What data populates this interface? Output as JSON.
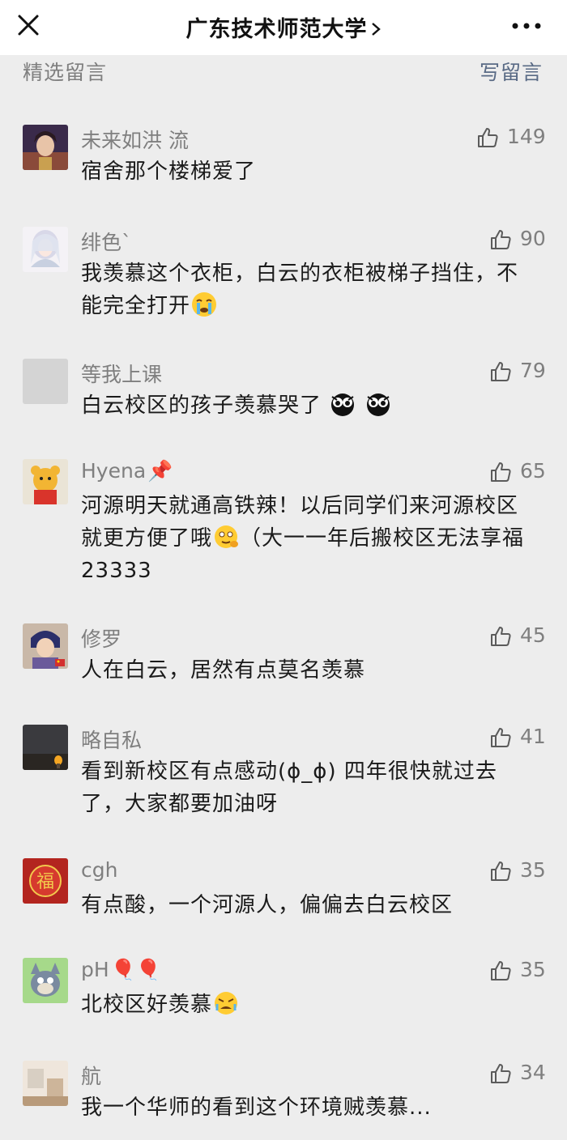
{
  "header": {
    "title": "广东技术师范大学",
    "chevron_icon": "chevron-right-icon",
    "close_icon": "close-icon",
    "more_icon": "more-dots-icon"
  },
  "section": {
    "label": "精选留言",
    "write_label": "写留言"
  },
  "comments": [
    {
      "nickname": "未来如洪 流",
      "nick_suffix": "",
      "likes": "149",
      "text": "宿舍那个楼梯爱了",
      "text_after": "",
      "emoji": "",
      "avatar": "anime-character-avatar"
    },
    {
      "nickname": "绯色`",
      "nick_suffix": "",
      "likes": "90",
      "text": "我羡慕这个衣柜，白云的衣柜被梯子挡住，不能完全打开",
      "text_after": "",
      "emoji": "crying-face-emoji",
      "avatar": "white-hair-character-avatar"
    },
    {
      "nickname": "等我上课",
      "nick_suffix": "",
      "likes": "79",
      "text": "白云校区的孩子羡慕哭了",
      "text_after": "",
      "emoji": "envious-face-emoji x2",
      "avatar": "blank-gray-avatar"
    },
    {
      "nickname": "Hyena",
      "nick_suffix": "📌",
      "likes": "65",
      "text": "河源明天就通高铁辣！以后同学们来河源校区就更方便了哦",
      "text_after": "（大一一年后搬校区无法享福23333",
      "emoji": "thinking-face-emoji",
      "avatar": "winnie-the-pooh-avatar"
    },
    {
      "nickname": "修罗",
      "nick_suffix": "",
      "likes": "45",
      "text": "人在白云，居然有点莫名羡慕",
      "text_after": "",
      "emoji": "",
      "avatar": "anime-boy-avatar"
    },
    {
      "nickname": "略自私",
      "nick_suffix": "",
      "likes": "41",
      "text": "看到新校区有点感动(ɸ_ɸ) 四年很快就过去了，大家都要加油呀",
      "text_after": "",
      "emoji": "",
      "avatar": "dark-candle-avatar"
    },
    {
      "nickname": "cgh",
      "nick_suffix": "",
      "likes": "35",
      "text": "有点酸，一个河源人，偏偏去白云校区",
      "text_after": "",
      "emoji": "",
      "avatar": "red-fu-character-avatar"
    },
    {
      "nickname": "pH",
      "nick_suffix": "🎈🎈",
      "likes": "35",
      "text": "北校区好羡慕",
      "text_after": "",
      "emoji": "sob-face-emoji",
      "avatar": "tom-cat-avatar"
    },
    {
      "nickname": "航",
      "nick_suffix": "",
      "likes": "34",
      "text": "我一个华师的看到这个环境贼羡慕...",
      "text_after": "",
      "emoji": "",
      "avatar": "room-photo-avatar"
    }
  ],
  "colors": {
    "background": "#ededed",
    "header_bg": "#ffffff",
    "nickname": "#7f7f7f",
    "link": "#596a85",
    "body_text": "#1a1a1a"
  }
}
